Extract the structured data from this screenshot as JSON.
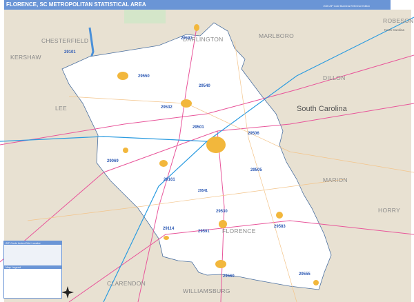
{
  "header": {
    "title": "FLORENCE, SC METROPOLITAN STATISTICAL AREA",
    "edition": "2026 ZIP Code Business Reference Edition",
    "logo": "Market MAPS"
  },
  "states": [
    "South Carolina",
    "North Carolina"
  ],
  "counties": [
    "CHESTERFIELD",
    "DARLINGTON",
    "MARLBORO",
    "ROBESON",
    "KERSHAW",
    "DILLON",
    "LEE",
    "MARION",
    "HORRY",
    "CLARENDON",
    "WILLIAMSBURG",
    "FLORENCE"
  ],
  "zip_codes": [
    "29593",
    "29101",
    "29550",
    "29540",
    "29532",
    "29501",
    "29506",
    "29069",
    "29161",
    "29505",
    "29541",
    "29530",
    "29583",
    "29114",
    "29591",
    "29560",
    "29555"
  ],
  "legend": {
    "title": "ZIP Code Index/Grid Locator",
    "section": "Map Legend"
  },
  "colors": {
    "header": "#6a95d6",
    "background": "#e8e1d2",
    "focus_area": "#ffffff",
    "interstate": "#2a9be0",
    "us_highway": "#e8559a",
    "state_road": "#f3c48a",
    "zip_boundary": "#7fa2d8",
    "urban": "#f2b73c"
  }
}
